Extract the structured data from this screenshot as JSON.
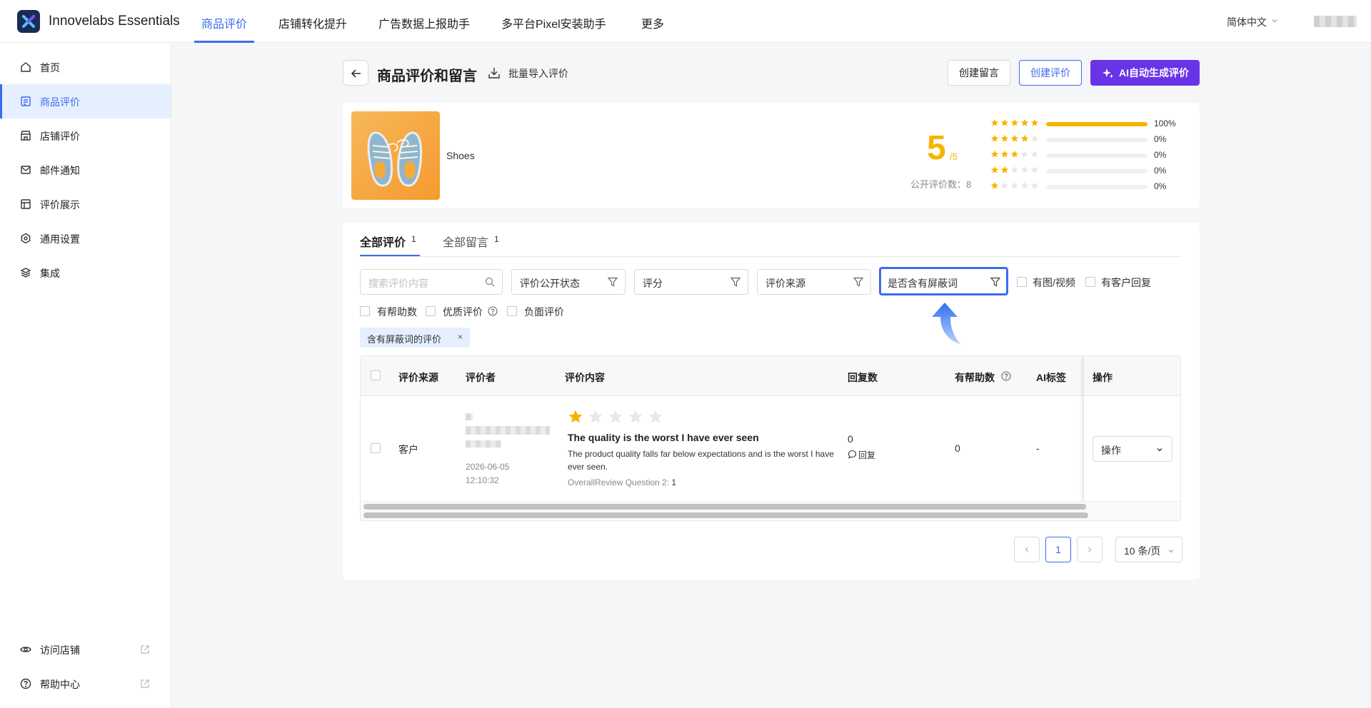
{
  "app": {
    "brand": "Innovelabs Essentials",
    "language": "简体中文"
  },
  "topnav": [
    {
      "label": "商品评价",
      "active": true
    },
    {
      "label": "店铺转化提升",
      "active": false
    },
    {
      "label": "广告数据上报助手",
      "active": false
    },
    {
      "label": "多平台Pixel安装助手",
      "active": false
    },
    {
      "label": "更多",
      "active": false
    }
  ],
  "sidebar": {
    "items": [
      {
        "label": "首页",
        "icon": "home-icon",
        "active": false
      },
      {
        "label": "商品评价",
        "icon": "review-list-icon",
        "active": true
      },
      {
        "label": "店铺评价",
        "icon": "store-icon",
        "active": false
      },
      {
        "label": "邮件通知",
        "icon": "mail-icon",
        "active": false
      },
      {
        "label": "评价展示",
        "icon": "layout-icon",
        "active": false
      },
      {
        "label": "通用设置",
        "icon": "settings-icon",
        "active": false
      },
      {
        "label": "集成",
        "icon": "layers-icon",
        "active": false
      }
    ],
    "bottom": [
      {
        "label": "访问店铺",
        "icon": "eye-icon"
      },
      {
        "label": "帮助中心",
        "icon": "help-icon"
      }
    ]
  },
  "header": {
    "title": "商品评价和留言",
    "import_label": "批量导入评价",
    "create_comment": "创建留言",
    "create_review": "创建评价",
    "ai_generate": "AI自动生成评价"
  },
  "product": {
    "name": "Shoes",
    "score": "5",
    "score_max": "/5",
    "public_count_label": "公开评价数：8",
    "distribution": [
      {
        "stars": 5,
        "percent": 100,
        "label": "100%"
      },
      {
        "stars": 4,
        "percent": 0,
        "label": "0%"
      },
      {
        "stars": 3,
        "percent": 0,
        "label": "0%"
      },
      {
        "stars": 2,
        "percent": 0,
        "label": "0%"
      },
      {
        "stars": 1,
        "percent": 0,
        "label": "0%"
      }
    ]
  },
  "tabs": [
    {
      "label": "全部评价",
      "count": "1",
      "active": true
    },
    {
      "label": "全部留言",
      "count": "1",
      "active": false
    }
  ],
  "filters": {
    "search_placeholder": "搜索评价内容",
    "public_status": "评价公开状态",
    "rating": "评分",
    "source": "评价来源",
    "blocked_words": "是否含有屏蔽词",
    "checkboxes": [
      "有图/视频",
      "有客户回复",
      "有帮助数",
      "优质评价",
      "负面评价"
    ],
    "active_tag": "含有屏蔽词的评价"
  },
  "table": {
    "columns": [
      "评价来源",
      "评价者",
      "评价内容",
      "回复数",
      "有帮助数",
      "AI标签",
      "操作"
    ],
    "rows": [
      {
        "source": "客户",
        "date": "2026-06-05",
        "time": "12:10:32",
        "rating": 1,
        "title": "The quality is the worst I have ever seen",
        "body": "The product quality falls far below expectations and is the worst I have ever seen.",
        "meta_label": "OverallReview Question 2:",
        "meta_value": "1",
        "reply_count": "0",
        "reply_label": "回复",
        "helpful": "0",
        "ai_tag": "-",
        "action": "操作"
      }
    ]
  },
  "pagination": {
    "current": "1",
    "page_size": "10 条/页"
  },
  "colors": {
    "primary": "#3b6cf0",
    "purple": "#6934e8",
    "star": "#f7b500"
  }
}
